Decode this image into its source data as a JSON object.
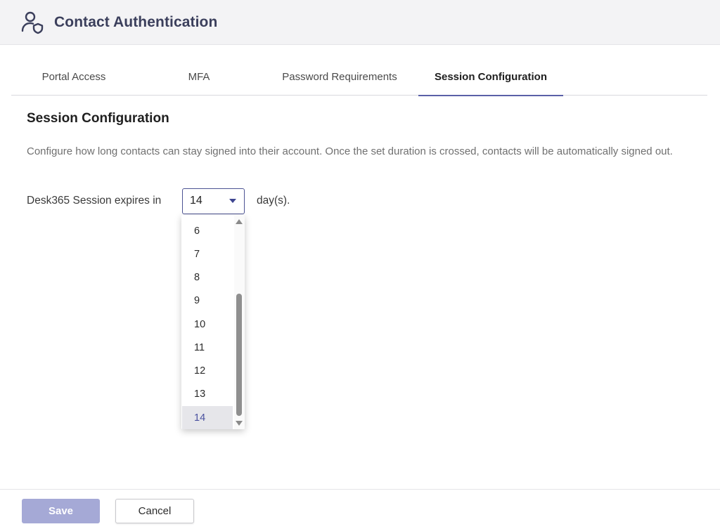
{
  "header": {
    "title": "Contact Authentication",
    "icon": "user-shield-icon"
  },
  "tabs": [
    {
      "label": "Portal Access",
      "active": false
    },
    {
      "label": "MFA",
      "active": false
    },
    {
      "label": "Password Requirements",
      "active": false
    },
    {
      "label": "Session Configuration",
      "active": true
    }
  ],
  "section": {
    "title": "Session Configuration",
    "description": "Configure how long contacts can stay signed into their account. Once the set duration is crossed, contacts will be automatically signed out."
  },
  "session": {
    "label": "Desk365 Session expires in",
    "selected_value": "14",
    "suffix": "day(s).",
    "visible_options": [
      "6",
      "7",
      "8",
      "9",
      "10",
      "11",
      "12",
      "13",
      "14"
    ]
  },
  "footer": {
    "save_label": "Save",
    "cancel_label": "Cancel"
  },
  "colors": {
    "accent": "#4c5393",
    "save_button": "#a5a9d6",
    "header_bg": "#f3f3f5"
  }
}
